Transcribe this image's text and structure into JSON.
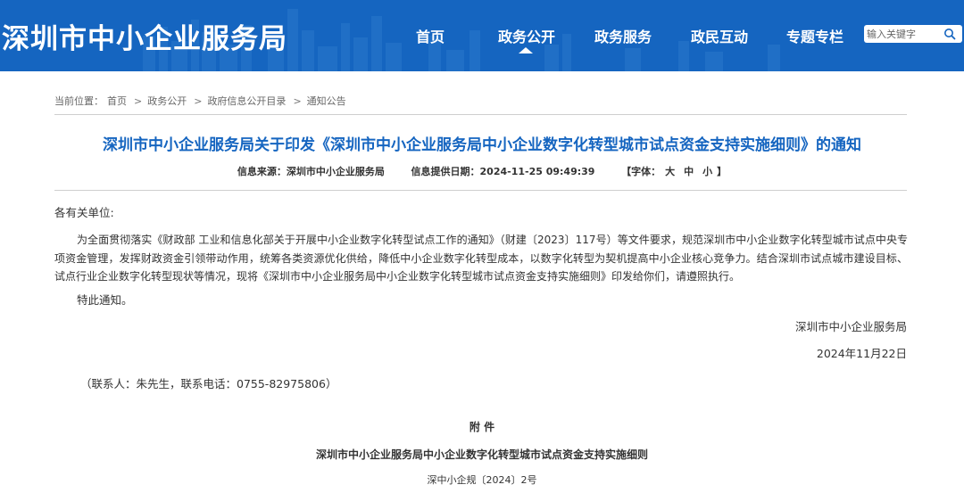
{
  "header": {
    "site_title": "深圳市中小企业服务局",
    "nav": [
      {
        "label": "首页"
      },
      {
        "label": "政务公开"
      },
      {
        "label": "政务服务"
      },
      {
        "label": "政民互动"
      },
      {
        "label": "专题专栏"
      }
    ],
    "active_nav": "政务公开",
    "search": {
      "placeholder": "输入关键字",
      "value": ""
    },
    "colors": {
      "bar": "#1565c0",
      "accent_title": "#1565c0"
    }
  },
  "breadcrumb": {
    "prefix": "当前位置：",
    "items": [
      "首页",
      "政务公开",
      "政府信息公开目录",
      "通知公告"
    ],
    "separator": ">"
  },
  "article": {
    "title": "深圳市中小企业服务局关于印发《深圳市中小企业服务局中小企业数字化转型城市试点资金支持实施细则》的通知",
    "source_label": "信息来源：",
    "source": "深圳市中小企业服务局",
    "date_label": "信息提供日期：",
    "date": "2024-11-25 09:49:39",
    "font_label": "【字体：",
    "font_sizes": [
      "大",
      "中",
      "小"
    ],
    "font_close": "】",
    "salutation": "各有关单位:",
    "paragraph": "为全面贯彻落实《财政部 工业和信息化部关于开展中小企业数字化转型试点工作的通知》（财建〔2023〕117号）等文件要求，规范深圳市中小企业数字化转型城市试点中央专项资金管理，发挥财政资金引领带动作用，统筹各类资源优化供给，降低中小企业数字化转型成本，以数字化转型为契机提高中小企业核心竞争力。结合深圳市试点城市建设目标、试点行业企业数字化转型现状等情况，现将《深圳市中小企业服务局中小企业数字化转型城市试点资金支持实施细则》印发给你们，请遵照执行。",
    "closing": "特此通知。",
    "signature": "深圳市中小企业服务局",
    "sign_date": "2024年11月22日",
    "contact": "（联系人：朱先生，联系电话：0755-82975806）",
    "attachment_label": "附  件",
    "attachment_title": "深圳市中小企业服务局中小企业数字化转型城市试点资金支持实施细则",
    "doc_number": "深中小企规〔2024〕2号"
  }
}
